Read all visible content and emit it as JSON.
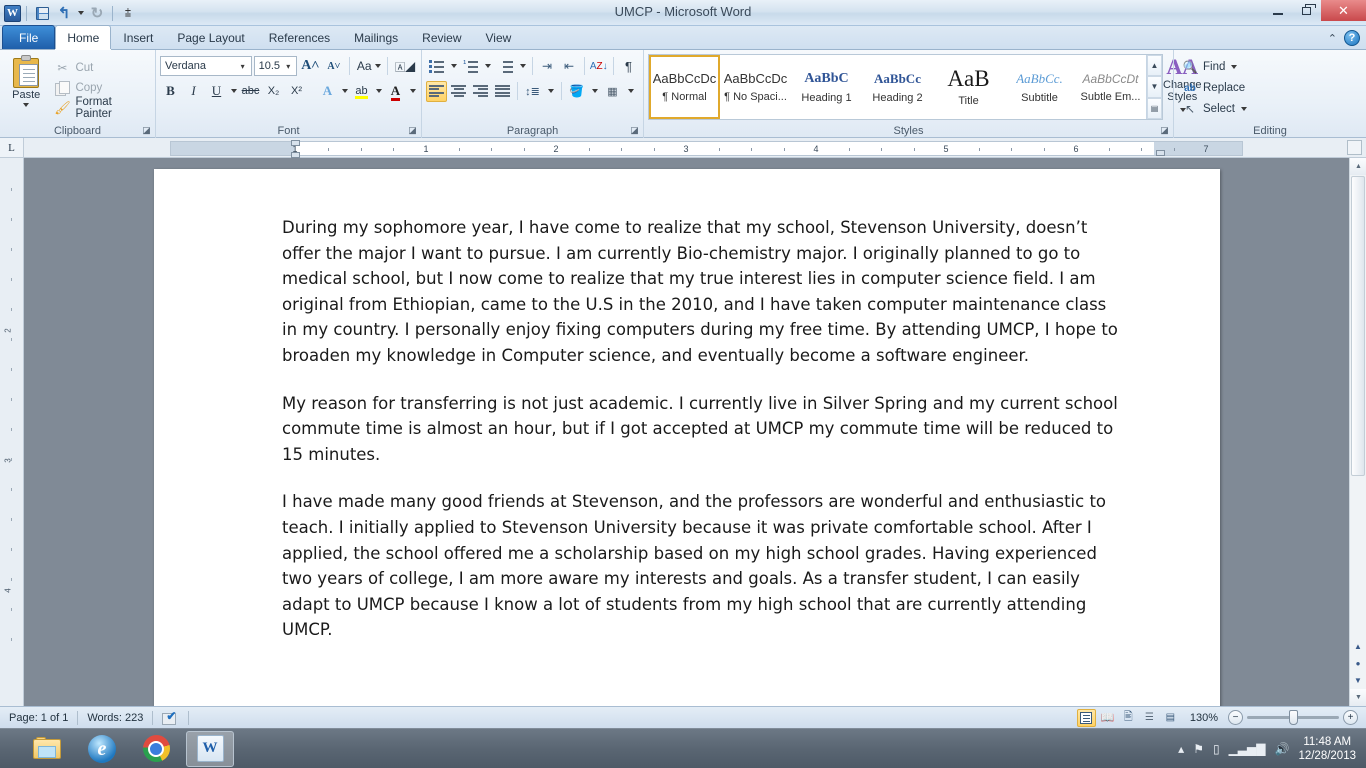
{
  "titlebar": {
    "app_badge": "W",
    "title": "UMCP  -  Microsoft Word",
    "qat": [
      {
        "name": "save",
        "label": "Save"
      },
      {
        "name": "undo",
        "label": "Undo"
      },
      {
        "name": "redo",
        "label": "Repeat"
      },
      {
        "name": "customize",
        "label": "Customize Quick Access Toolbar"
      }
    ],
    "window_buttons": {
      "minimize": "Minimize",
      "restore": "Restore Down",
      "close": "✕"
    }
  },
  "tabs": [
    {
      "label": "File",
      "active": false,
      "file": true
    },
    {
      "label": "Home",
      "active": true
    },
    {
      "label": "Insert",
      "active": false
    },
    {
      "label": "Page Layout",
      "active": false
    },
    {
      "label": "References",
      "active": false
    },
    {
      "label": "Mailings",
      "active": false
    },
    {
      "label": "Review",
      "active": false
    },
    {
      "label": "View",
      "active": false
    }
  ],
  "tabbar_right": {
    "collapse_icon": "⌃",
    "help_icon": "?"
  },
  "ribbon": {
    "clipboard": {
      "label": "Clipboard",
      "paste_label": "Paste",
      "items": [
        {
          "label": "Cut",
          "icon": "scissors-icon"
        },
        {
          "label": "Copy",
          "icon": "copy-icon"
        },
        {
          "label": "Format Painter",
          "icon": "format-painter-icon"
        }
      ]
    },
    "font": {
      "label": "Font",
      "font_name": "Verdana",
      "font_size": "10.5",
      "buttons": [
        {
          "name": "grow-font",
          "label": "A"
        },
        {
          "name": "shrink-font",
          "label": "A"
        },
        {
          "name": "change-case",
          "label": "Aa"
        },
        {
          "name": "clear-formatting",
          "label": "Aa"
        },
        {
          "name": "bold",
          "label": "B"
        },
        {
          "name": "italic",
          "label": "I"
        },
        {
          "name": "underline",
          "label": "U"
        },
        {
          "name": "strikethrough",
          "label": "abc"
        },
        {
          "name": "subscript",
          "label": "X₂"
        },
        {
          "name": "superscript",
          "label": "X²"
        },
        {
          "name": "text-effects",
          "label": "A"
        },
        {
          "name": "text-highlight-color",
          "label": "ab"
        },
        {
          "name": "font-color",
          "label": "A"
        }
      ]
    },
    "paragraph": {
      "label": "Paragraph",
      "buttons": [
        {
          "name": "bullets",
          "label": "Bullets"
        },
        {
          "name": "numbering",
          "label": "Numbering"
        },
        {
          "name": "multilevel-list",
          "label": "Multilevel List"
        },
        {
          "name": "decrease-indent",
          "label": "Decrease Indent"
        },
        {
          "name": "increase-indent",
          "label": "Increase Indent"
        },
        {
          "name": "sort",
          "label": "Sort"
        },
        {
          "name": "show-formatting-marks",
          "label": "¶"
        },
        {
          "name": "align-left",
          "label": "Align Text Left",
          "active": true
        },
        {
          "name": "align-center",
          "label": "Center"
        },
        {
          "name": "align-right",
          "label": "Align Text Right"
        },
        {
          "name": "justify",
          "label": "Justify"
        },
        {
          "name": "line-spacing",
          "label": "Line and Paragraph Spacing"
        },
        {
          "name": "shading",
          "label": "Shading"
        },
        {
          "name": "borders",
          "label": "Borders"
        }
      ]
    },
    "styles": {
      "label": "Styles",
      "change_styles_line1": "Change",
      "change_styles_line2": "Styles",
      "gallery": [
        {
          "preview": "AaBbCcDc",
          "name": "¶ Normal",
          "selected": true,
          "kind": "normal"
        },
        {
          "preview": "AaBbCcDc",
          "name": "¶ No Spaci...",
          "selected": false,
          "kind": "normal"
        },
        {
          "preview": "AaBbC",
          "name": "Heading 1",
          "selected": false,
          "kind": "h1"
        },
        {
          "preview": "AaBbCc",
          "name": "Heading 2",
          "selected": false,
          "kind": "h2"
        },
        {
          "preview": "AaB",
          "name": "Title",
          "selected": false,
          "kind": "title"
        },
        {
          "preview": "AaBbCc.",
          "name": "Subtitle",
          "selected": false,
          "kind": "sub"
        },
        {
          "preview": "AaBbCcDt",
          "name": "Subtle Em...",
          "selected": false,
          "kind": "subem"
        }
      ]
    },
    "editing": {
      "label": "Editing",
      "items": [
        {
          "label": "Find",
          "icon": "binoculars-icon",
          "has_dropdown": true
        },
        {
          "label": "Replace",
          "icon": "replace-icon",
          "has_dropdown": false
        },
        {
          "label": "Select",
          "icon": "cursor-icon",
          "has_dropdown": true
        }
      ]
    }
  },
  "ruler": {
    "tab_selector_glyph": "L",
    "numbers": [
      "1",
      "2",
      "3",
      "4",
      "5",
      "6",
      "7"
    ]
  },
  "document": {
    "paragraphs": [
      {
        "indent": false,
        "text": "During my sophomore year, I have come to realize that my school, Stevenson University, doesn’t offer the major I want to pursue. I am currently Bio-chemistry major. I originally planned to go to medical school, but I now come to realize that my true interest lies in computer science field. I am original from Ethiopian, came to the U.S in the 2010, and I have taken computer maintenance class in my country. I personally enjoy fixing computers during my free time. By attending UMCP, I hope to broaden my knowledge in Computer science, and eventually become a software engineer."
      },
      {
        "indent": false,
        "text": "My reason for transferring is not just academic. I currently live in Silver Spring and my current school commute time is almost an hour, but if I got accepted at UMCP my commute time will be reduced to 15 minutes."
      },
      {
        "indent": true,
        "text": "  I have made many good friends at Stevenson, and the professors are wonderful and enthusiastic to teach. I initially applied to Stevenson University because it was private comfortable school.  After I applied, the school offered me a scholarship based on my high school grades.  Having experienced two years of college, I am more aware my interests and goals. As a transfer student, I can easily adapt to UMCP because I know a lot of students from my high school that are currently attending UMCP."
      }
    ]
  },
  "statusbar": {
    "page": "Page: 1 of 1",
    "words": "Words: 223",
    "proofing_icon": "proofing-errors-icon",
    "views": [
      {
        "name": "print-layout",
        "label": "Print Layout",
        "active": true
      },
      {
        "name": "full-screen-reading",
        "label": "Full Screen Reading",
        "active": false
      },
      {
        "name": "web-layout",
        "label": "Web Layout",
        "active": false
      },
      {
        "name": "outline",
        "label": "Outline",
        "active": false
      },
      {
        "name": "draft",
        "label": "Draft",
        "active": false
      }
    ],
    "zoom": "130%",
    "zoom_out": "−",
    "zoom_in": "+"
  },
  "taskbar": {
    "items": [
      {
        "name": "windows-explorer",
        "label": "Windows Explorer",
        "active": false
      },
      {
        "name": "internet-explorer",
        "label": "Internet Explorer",
        "active": false,
        "glyph": "e"
      },
      {
        "name": "google-chrome",
        "label": "Google Chrome",
        "active": false
      },
      {
        "name": "microsoft-word",
        "label": "UMCP - Microsoft Word",
        "active": true,
        "glyph": "W"
      }
    ],
    "tray": [
      {
        "name": "show-hidden-icons",
        "glyph": "▴"
      },
      {
        "name": "action-center-flag",
        "glyph": "⚑"
      },
      {
        "name": "battery",
        "glyph": "▯"
      },
      {
        "name": "network-signal",
        "glyph": "▁▃▅▇"
      },
      {
        "name": "volume",
        "glyph": "🔊"
      }
    ],
    "clock_time": "11:48 AM",
    "clock_date": "12/28/2013"
  }
}
